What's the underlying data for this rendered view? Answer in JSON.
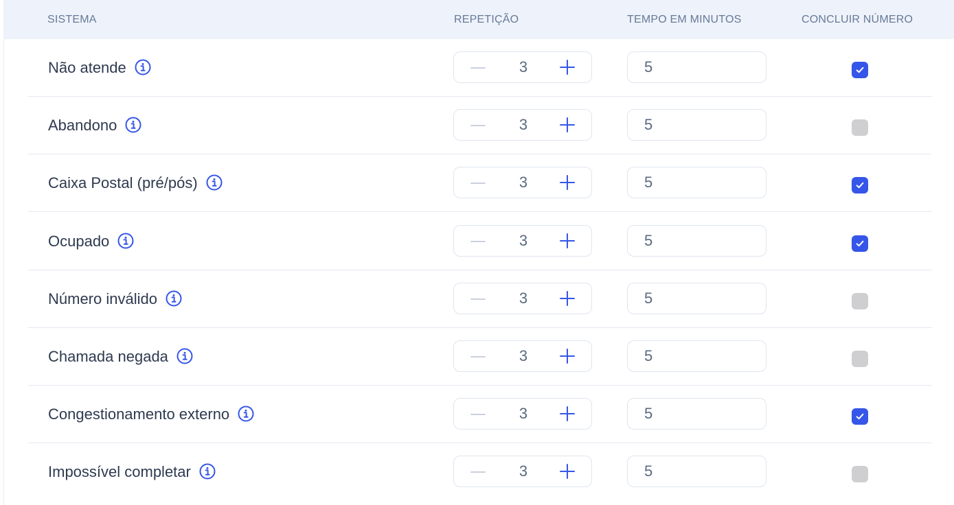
{
  "header": {
    "col_system": "SISTEMA",
    "col_repeat": "REPETIÇÃO",
    "col_time": "TEMPO EM MINUTOS",
    "col_complete": "CONCLUIR NÚMERO"
  },
  "colors": {
    "accent": "#3556e8",
    "header_bg": "#eef2fa",
    "checkbox_off": "#cfcfd1"
  },
  "rows": [
    {
      "label": "Não atende",
      "repeat": "3",
      "time": "5",
      "complete": true
    },
    {
      "label": "Abandono",
      "repeat": "3",
      "time": "5",
      "complete": false
    },
    {
      "label": "Caixa Postal (pré/pós)",
      "repeat": "3",
      "time": "5",
      "complete": true
    },
    {
      "label": "Ocupado",
      "repeat": "3",
      "time": "5",
      "complete": true
    },
    {
      "label": "Número inválido",
      "repeat": "3",
      "time": "5",
      "complete": false
    },
    {
      "label": "Chamada negada",
      "repeat": "3",
      "time": "5",
      "complete": false
    },
    {
      "label": "Congestionamento externo",
      "repeat": "3",
      "time": "5",
      "complete": true
    },
    {
      "label": "Impossível completar",
      "repeat": "3",
      "time": "5",
      "complete": false
    }
  ]
}
